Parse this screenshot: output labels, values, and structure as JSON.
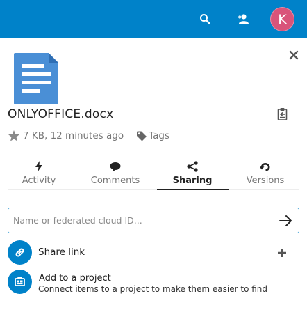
{
  "header": {
    "avatar_letter": "K",
    "avatar_color": "#d9547a",
    "brand_color": "#0082c9",
    "icons": [
      "search-icon",
      "contacts-icon"
    ]
  },
  "file": {
    "name": "ONLYOFFICE.docx",
    "meta": "7 KB, 12 minutes ago",
    "tags_label": "Tags",
    "icon": "document-icon"
  },
  "tabs": [
    {
      "label": "Activity",
      "icon": "lightning-icon",
      "active": false
    },
    {
      "label": "Comments",
      "icon": "comment-icon",
      "active": false
    },
    {
      "label": "Sharing",
      "icon": "share-icon",
      "active": true
    },
    {
      "label": "Versions",
      "icon": "history-icon",
      "active": false
    }
  ],
  "sharing": {
    "input_placeholder": "Name or federated cloud ID...",
    "share_link_label": "Share link",
    "project_title": "Add to a project",
    "project_subtitle": "Connect items to a project to make them easier to find"
  }
}
